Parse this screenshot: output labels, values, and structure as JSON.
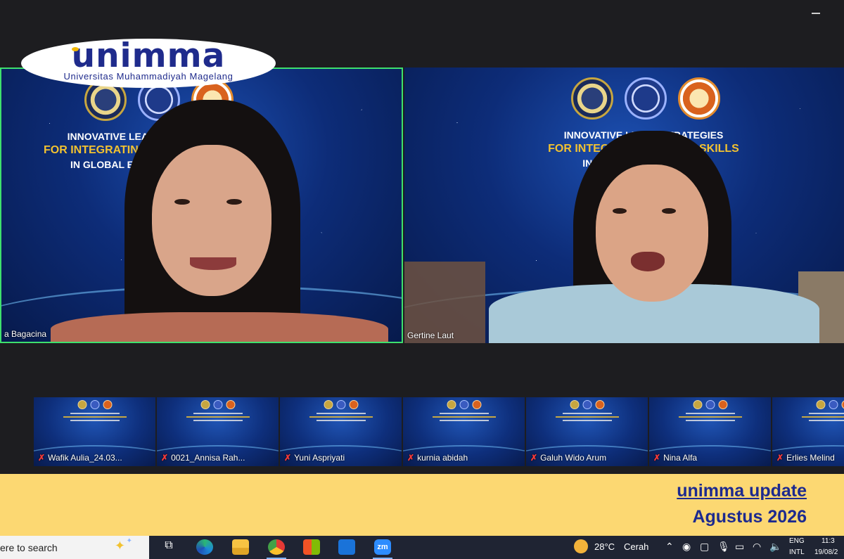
{
  "logo": {
    "word": "unimma",
    "subtitle": "Universitas Muhammadiyah Magelang"
  },
  "tiles": [
    {
      "name": "a Bagacina",
      "banner": [
        "INNOVATIVE LEARNING STRATEGIES",
        "FOR INTEGRATING",
        "IN GLOBAL E"
      ]
    },
    {
      "name": "Gertine Laut",
      "banner": [
        "INNOVATIVE LEA      STRATEGIES",
        "FOR INTEGRAT           TURY SKILLS",
        "IN GLOB                  TEXTS"
      ]
    }
  ],
  "gallery": [
    {
      "name": "Wafik Aulia_24.03..."
    },
    {
      "name": "0021_Annisa Rah..."
    },
    {
      "name": "Yuni Aspriyati"
    },
    {
      "name": "kurnia abidah"
    },
    {
      "name": "Galuh Wido Arum"
    },
    {
      "name": "Nina Alfa"
    },
    {
      "name": "Erlies Melind"
    }
  ],
  "band": {
    "title": "unimma update",
    "date": "Agustus 2026",
    "bg_color": "#fcd872",
    "text_color": "#1d2a8f"
  },
  "taskbar": {
    "search_text": "ere to search",
    "weather_temp": "28°C",
    "weather_desc": "Cerah",
    "lang_top": "ENG",
    "lang_bottom": "INTL",
    "time": "11:3",
    "date": "19/08/2"
  },
  "icons": [
    "task-view-icon",
    "edge-icon",
    "file-explorer-icon",
    "chrome-icon",
    "store-icon",
    "outlook-icon",
    "zoom-icon",
    "weather-icon",
    "chevron-up-icon",
    "meet-icon",
    "camera-icon",
    "mic-icon",
    "battery-icon",
    "wifi-icon",
    "speaker-icon"
  ]
}
